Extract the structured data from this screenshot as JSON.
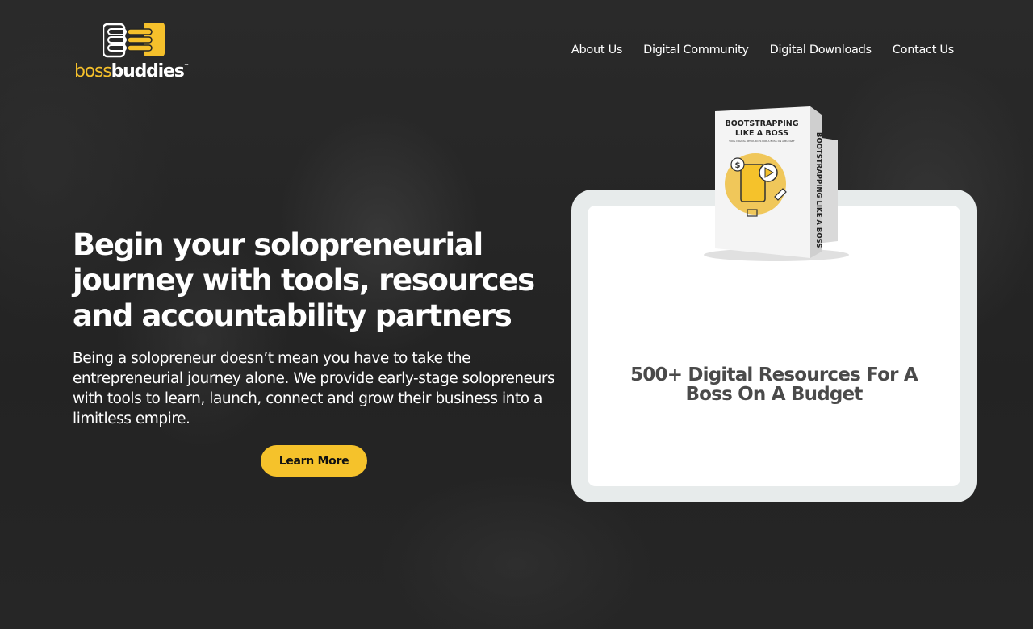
{
  "brand": {
    "name_part1": "boss",
    "name_part2": "buddies",
    "trademark": "™",
    "accent_color": "#f5c22b"
  },
  "nav": {
    "items": [
      {
        "label": "About Us"
      },
      {
        "label": "Digital Community"
      },
      {
        "label": "Digital Downloads"
      },
      {
        "label": "Contact Us"
      }
    ]
  },
  "hero": {
    "headline": "Begin your solopreneurial journey with tools, resources and accountability partners",
    "body": "Being a solopreneur doesn’t mean you have to take the entrepreneurial journey alone. We provide early-stage solopreneurs with tools to learn, launch, connect and grow their business into a limitless empire.",
    "cta_label": "Learn More"
  },
  "promo_card": {
    "title": "500+ Digital Resources For A Boss On A Budget",
    "product_title_line1": "BOOTSTRAPPING",
    "product_title_line2": "LIKE A BOSS",
    "product_subtitle": "500+ DIGITAL RESOURCES FOR A BOSS ON A BUDGET",
    "product_spine": "BOOTSTRAPPING LIKE A BOSS"
  }
}
